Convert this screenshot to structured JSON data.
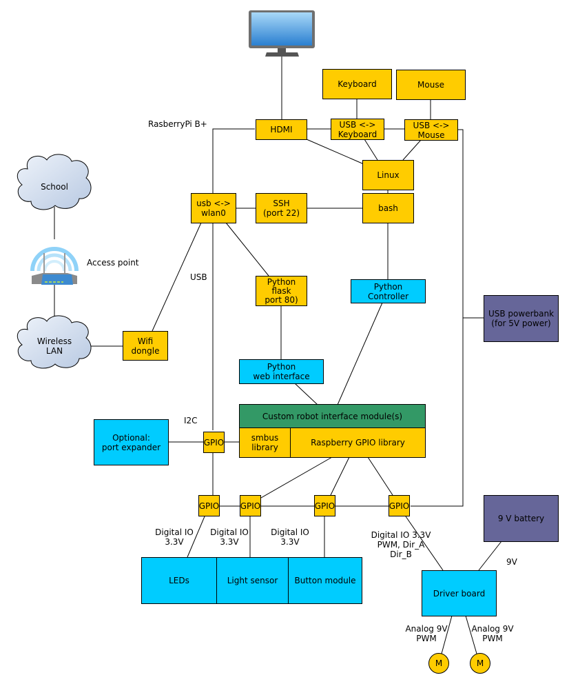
{
  "title": "RasberryPi B+",
  "colors": {
    "software": "#ffcc00",
    "hardware_module": "#00ccff",
    "custom_module": "#339966",
    "power": "#666699",
    "cloud": "#d6e2f2"
  },
  "icons": {
    "monitor": "monitor-icon",
    "router": "wifi-router-icon"
  },
  "clouds": {
    "school": "School",
    "wireless_lan": "Wireless\nLAN"
  },
  "nodes": {
    "keyboard": "Keyboard",
    "mouse": "Mouse",
    "hdmi": "HDMI",
    "usb_keyboard": "USB <->\nKeyboard",
    "usb_mouse": "USB <->\nMouse",
    "linux": "Linux",
    "bash": "bash",
    "usb_wlan0": "usb <->\nwlan0",
    "ssh": "SSH\n(port 22)",
    "python_flask": "Python\nflask\nport 80)",
    "python_controller": "Python\nController",
    "usb_powerbank": "USB powerbank\n(for 5V power)",
    "wifi_dongle": "Wifi\ndongle",
    "python_web_interface": "Python\nweb interface",
    "custom_robot_module": "Custom robot interface module(s)",
    "smbus_library": "smbus\nlibrary",
    "gpio_library": "Raspberry GPIO library",
    "port_expander": "Optional:\nport expander",
    "gpio_i2c": "GPIO",
    "gpio_1": "GPIO",
    "gpio_2": "GPIO",
    "gpio_3": "GPIO",
    "gpio_4": "GPIO",
    "leds": "LEDs",
    "light_sensor": "Light sensor",
    "button_module": "Button module",
    "battery": "9 V battery",
    "driver_board": "Driver board",
    "motor_1": "M",
    "motor_2": "M"
  },
  "labels": {
    "access_point": "Access point",
    "usb": "USB",
    "i2c": "I2C",
    "dio_leds": "Digital IO\n3.3V",
    "dio_light": "Digital IO\n3.3V",
    "dio_button": "Digital IO\n3.3V",
    "dio_driver": "Digital IO 3.3V\nPWM, Dir_A\nDir_B",
    "nine_v": "9V",
    "analog_1": "Analog 9V\nPWM",
    "analog_2": "Analog 9V\nPWM"
  }
}
